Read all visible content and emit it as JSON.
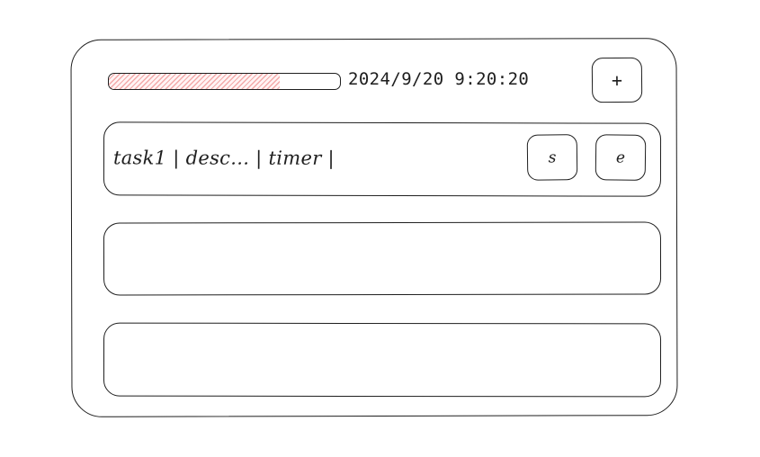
{
  "header": {
    "progress": {
      "value": 0.74,
      "fill_color": "#e03131"
    },
    "datetime": "2024/9/20 9:20:20",
    "add_button_label": "+"
  },
  "tasks": [
    {
      "text": "task1 | desc... | timer |",
      "start_button_label": "s",
      "end_button_label": "e"
    },
    {
      "text": ""
    },
    {
      "text": ""
    }
  ]
}
